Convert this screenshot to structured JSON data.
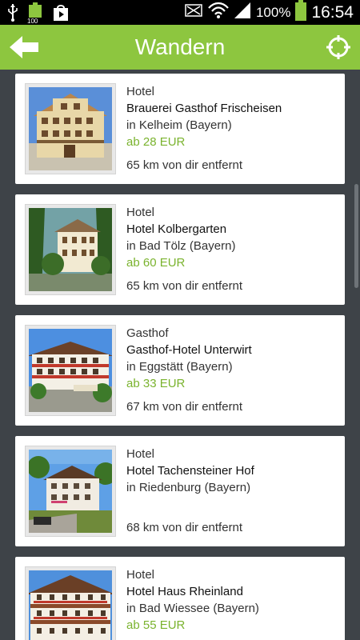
{
  "status_bar": {
    "battery_percent": "100%",
    "time": "16:54",
    "icons": [
      "usb-icon",
      "battery-small-icon",
      "play-store-icon",
      "mute-icon",
      "wifi-icon",
      "signal-icon",
      "battery-icon"
    ]
  },
  "header": {
    "title": "Wandern",
    "back_icon": "arrow-left-icon",
    "locate_icon": "crosshair-icon",
    "color": "#8dc63f"
  },
  "hotels": [
    {
      "type": "Hotel",
      "name": "Brauerei Gasthof Frischeisen",
      "location": "in Kelheim (Bayern)",
      "price": "ab 28 EUR",
      "distance": "65 km von dir entfernt"
    },
    {
      "type": "Hotel",
      "name": "Hotel Kolbergarten",
      "location": "in Bad Tölz (Bayern)",
      "price": "ab 60 EUR",
      "distance": "65 km von dir entfernt"
    },
    {
      "type": "Gasthof",
      "name": "Gasthof-Hotel Unterwirt",
      "location": "in Eggstätt (Bayern)",
      "price": "ab 33 EUR",
      "distance": "67 km von dir entfernt"
    },
    {
      "type": "Hotel",
      "name": "Hotel Tachensteiner Hof",
      "location": "in Riedenburg (Bayern)",
      "price": "",
      "distance": "68 km von dir entfernt"
    },
    {
      "type": "Hotel",
      "name": "Hotel Haus Rheinland",
      "location": "in Bad Wiessee (Bayern)",
      "price": "ab 55 EUR",
      "distance": ""
    }
  ],
  "colors": {
    "price": "#7ab32e",
    "background": "#3e4348"
  }
}
